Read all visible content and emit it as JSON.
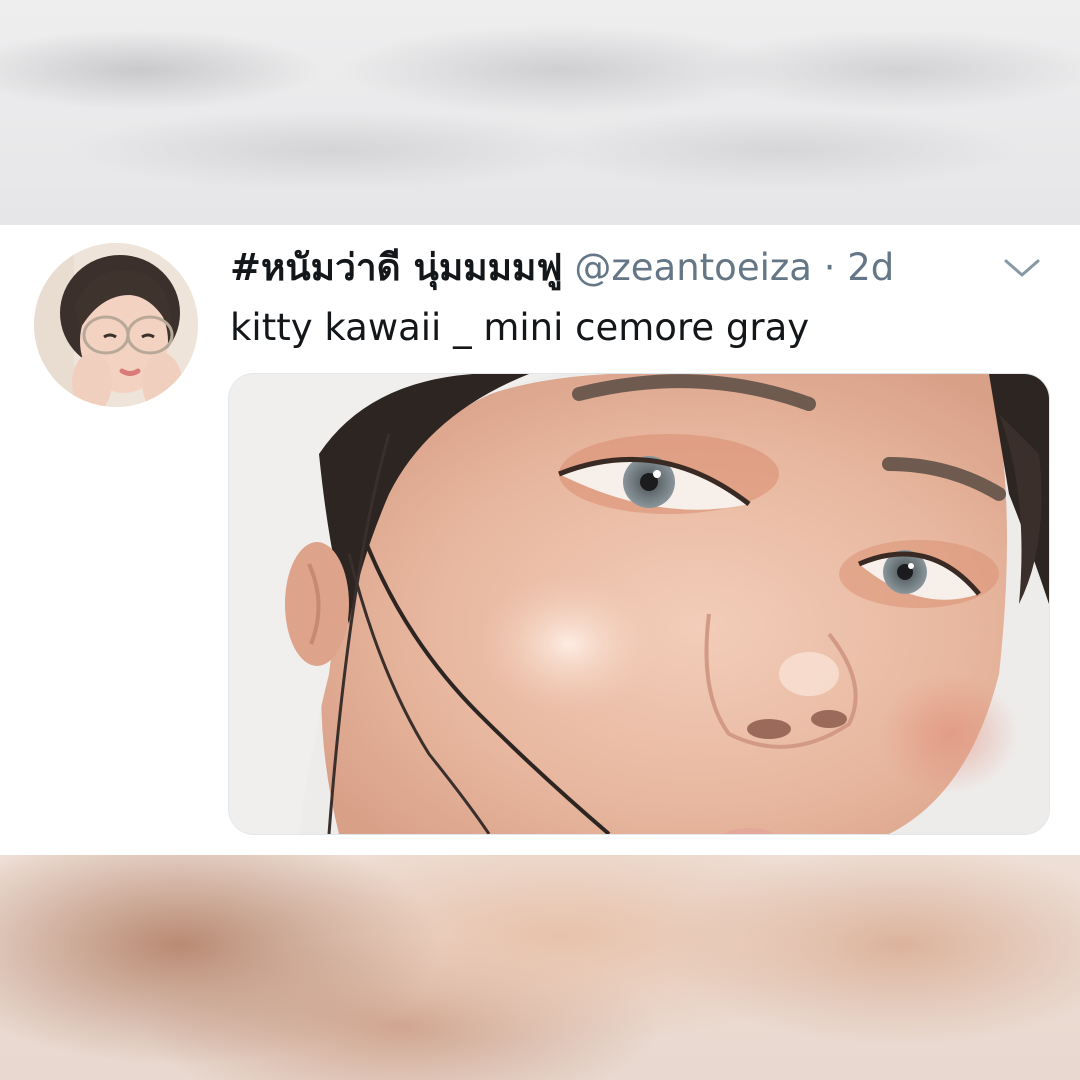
{
  "tweet": {
    "display_name": "#หนัมว่าดี นุ่มมมมฟู",
    "handle": "@zeantoeiza",
    "separator": "·",
    "time": "2d",
    "text": "kitty kawaii _ mini cemore gray",
    "menu_icon": "chevron-down-icon",
    "avatar_icon": "user-avatar-photo",
    "media_icon": "close-up-face-photo"
  },
  "colors": {
    "text_primary": "#14171a",
    "text_secondary": "#657786",
    "card_background": "#ffffff"
  }
}
